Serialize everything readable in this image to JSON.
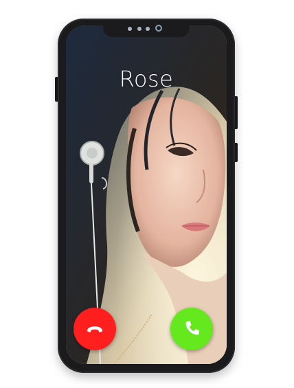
{
  "call": {
    "caller_name": "Rose",
    "decline_icon": "phone-hangup-icon",
    "accept_icon": "phone-icon"
  },
  "colors": {
    "decline": "#ff1f1f",
    "accept": "#66e81e",
    "phone_frame": "#1b1b1d"
  }
}
